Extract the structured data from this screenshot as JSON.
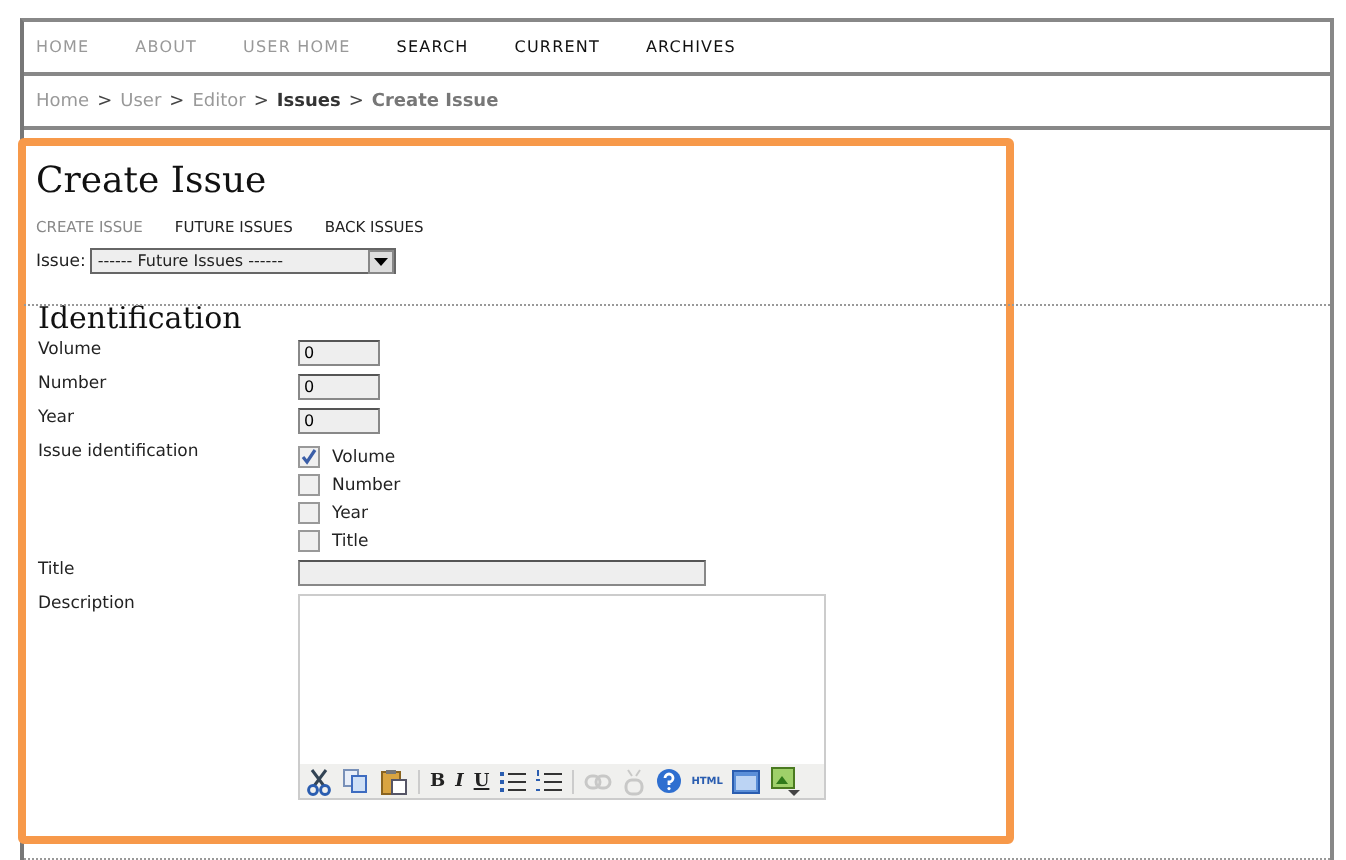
{
  "nav": [
    {
      "label": "HOME",
      "muted": true
    },
    {
      "label": "ABOUT",
      "muted": true
    },
    {
      "label": "USER HOME",
      "muted": true
    },
    {
      "label": "SEARCH",
      "muted": false
    },
    {
      "label": "CURRENT",
      "muted": false
    },
    {
      "label": "ARCHIVES",
      "muted": false
    }
  ],
  "breadcrumb": [
    {
      "label": "Home",
      "kind": "visited"
    },
    {
      "label": "User",
      "kind": "visited"
    },
    {
      "label": "Editor",
      "kind": "visited"
    },
    {
      "label": "Issues",
      "kind": "link"
    },
    {
      "label": "Create Issue",
      "kind": "current"
    }
  ],
  "breadcrumb_separator": ">",
  "page_title": "Create Issue",
  "tabs": [
    {
      "label": "CREATE ISSUE",
      "selected": true
    },
    {
      "label": "FUTURE ISSUES",
      "selected": false
    },
    {
      "label": "BACK ISSUES",
      "selected": false
    }
  ],
  "issue_select": {
    "label": "Issue:",
    "value": "------ Future Issues ------"
  },
  "section_title": "Identification",
  "fields": [
    {
      "label": "Volume",
      "value": "0"
    },
    {
      "label": "Number",
      "value": "0"
    },
    {
      "label": "Year",
      "value": "0"
    }
  ],
  "issue_identification": {
    "label": "Issue identification",
    "options": [
      {
        "label": "Volume",
        "checked": true
      },
      {
        "label": "Number",
        "checked": false
      },
      {
        "label": "Year",
        "checked": false
      },
      {
        "label": "Title",
        "checked": false
      }
    ]
  },
  "title_field": {
    "label": "Title"
  },
  "description_field": {
    "label": "Description"
  },
  "toolbar": [
    {
      "kind": "cut",
      "disabled": false
    },
    {
      "kind": "copy",
      "disabled": false
    },
    {
      "kind": "paste",
      "disabled": false
    },
    {
      "kind": "sep"
    },
    {
      "kind": "bold",
      "label": "B",
      "disabled": false
    },
    {
      "kind": "italic",
      "label": "I",
      "disabled": false
    },
    {
      "kind": "underline",
      "label": "U",
      "disabled": false
    },
    {
      "kind": "bullets",
      "disabled": false
    },
    {
      "kind": "numbers",
      "disabled": false
    },
    {
      "kind": "sep"
    },
    {
      "kind": "link",
      "disabled": true
    },
    {
      "kind": "unlink",
      "disabled": true
    },
    {
      "kind": "help",
      "disabled": false
    },
    {
      "kind": "html",
      "label": "HTML",
      "disabled": false
    },
    {
      "kind": "window",
      "disabled": false
    },
    {
      "kind": "image",
      "disabled": false
    }
  ]
}
